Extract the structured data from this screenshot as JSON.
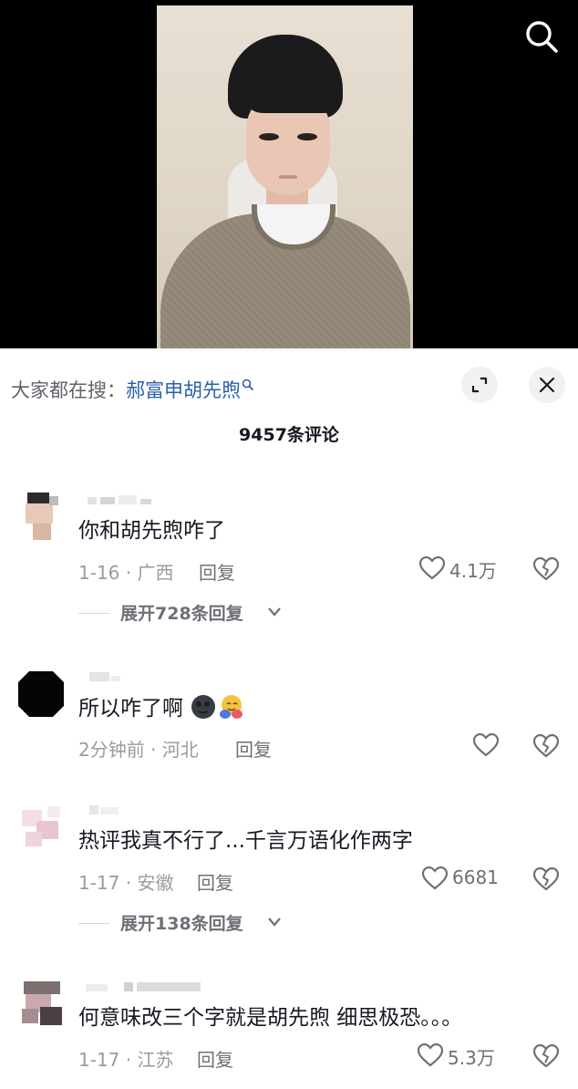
{
  "search_bar": {
    "prefix": "大家都在搜：",
    "term": "郝富申胡先煦"
  },
  "comments_count": "9457条评论",
  "comments": [
    {
      "text": "你和胡先煦咋了",
      "meta": "1-16 · 广西",
      "reply": "回复",
      "likes": "4.1万",
      "expand": "展开728条回复"
    },
    {
      "text": "所以咋了啊",
      "meta": "2分钟前 · 河北",
      "reply": "回复",
      "likes": "",
      "emoji": [
        "new-moon-face-emoji",
        "hugging-face-emoji"
      ]
    },
    {
      "text": "热评我真不行了...千言万语化作两字",
      "meta": "1-17 · 安徽",
      "reply": "回复",
      "likes": "6681",
      "expand": "展开138条回复"
    },
    {
      "text": "何意味改三个字就是胡先煦 细思极恐。。。",
      "meta": "1-17 · 江苏",
      "reply": "回复",
      "likes": "5.3万"
    }
  ],
  "icons": {
    "top_search": "search-icon",
    "expand": "expand-icon",
    "close": "close-icon",
    "like": "heart-icon",
    "dislike": "broken-heart-icon"
  },
  "colors": {
    "search_term": "#2c5fa8",
    "secondary_text": "#9a9ba1",
    "video_background": "#000000"
  }
}
